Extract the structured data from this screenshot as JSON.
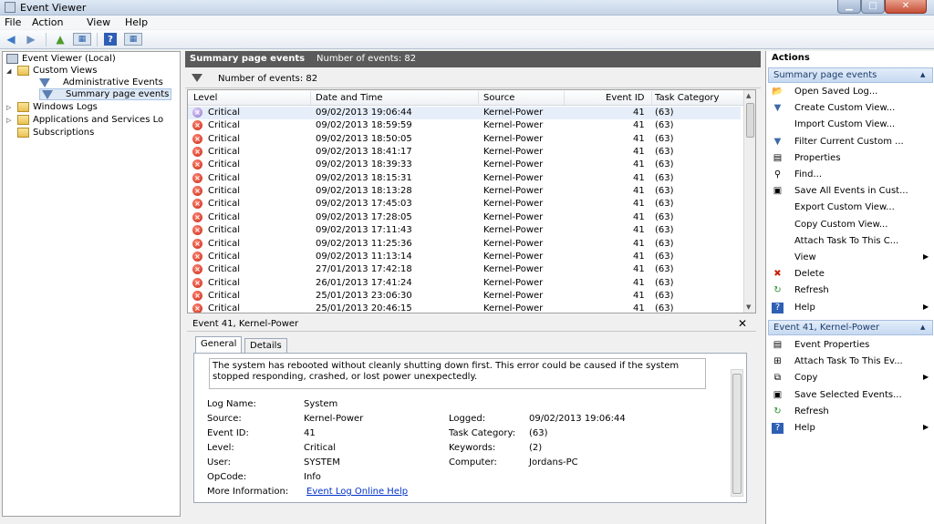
{
  "window": {
    "title": "Event Viewer",
    "minimize_glyph": "▁",
    "maximize_glyph": "□",
    "close_glyph": "✕"
  },
  "menu": [
    {
      "label": "File",
      "key": "F"
    },
    {
      "label": "Action",
      "key": "A"
    },
    {
      "label": "View",
      "key": "V"
    },
    {
      "label": "Help",
      "key": "H"
    }
  ],
  "toolbar": {
    "back_icon": "◀",
    "forward_icon": "▶",
    "folder_icon": "▲",
    "panel_icon": "▦",
    "help_icon": "?",
    "panel2_icon": "▦"
  },
  "tree": {
    "root": "Event Viewer (Local)",
    "custom_views": "Custom Views",
    "admin_events": "Administrative Events",
    "summary_events": "Summary page events",
    "windows_logs": "Windows Logs",
    "apps_services": "Applications and Services Lo",
    "subscriptions": "Subscriptions"
  },
  "center": {
    "header_name": "Summary page events",
    "header_count": "Number of events: 82",
    "filter_text": "Number of events: 82"
  },
  "grid": {
    "columns": [
      "Level",
      "Date and Time",
      "Source",
      "Event ID",
      "Task Category"
    ],
    "rows": [
      {
        "level": "Critical",
        "date": "09/02/2013 19:06:44",
        "source": "Kernel-Power",
        "id": "41",
        "task": "(63)"
      },
      {
        "level": "Critical",
        "date": "09/02/2013 18:59:59",
        "source": "Kernel-Power",
        "id": "41",
        "task": "(63)"
      },
      {
        "level": "Critical",
        "date": "09/02/2013 18:50:05",
        "source": "Kernel-Power",
        "id": "41",
        "task": "(63)"
      },
      {
        "level": "Critical",
        "date": "09/02/2013 18:41:17",
        "source": "Kernel-Power",
        "id": "41",
        "task": "(63)"
      },
      {
        "level": "Critical",
        "date": "09/02/2013 18:39:33",
        "source": "Kernel-Power",
        "id": "41",
        "task": "(63)"
      },
      {
        "level": "Critical",
        "date": "09/02/2013 18:15:31",
        "source": "Kernel-Power",
        "id": "41",
        "task": "(63)"
      },
      {
        "level": "Critical",
        "date": "09/02/2013 18:13:28",
        "source": "Kernel-Power",
        "id": "41",
        "task": "(63)"
      },
      {
        "level": "Critical",
        "date": "09/02/2013 17:45:03",
        "source": "Kernel-Power",
        "id": "41",
        "task": "(63)"
      },
      {
        "level": "Critical",
        "date": "09/02/2013 17:28:05",
        "source": "Kernel-Power",
        "id": "41",
        "task": "(63)"
      },
      {
        "level": "Critical",
        "date": "09/02/2013 17:11:43",
        "source": "Kernel-Power",
        "id": "41",
        "task": "(63)"
      },
      {
        "level": "Critical",
        "date": "09/02/2013 11:25:36",
        "source": "Kernel-Power",
        "id": "41",
        "task": "(63)"
      },
      {
        "level": "Critical",
        "date": "09/02/2013 11:13:14",
        "source": "Kernel-Power",
        "id": "41",
        "task": "(63)"
      },
      {
        "level": "Critical",
        "date": "27/01/2013 17:42:18",
        "source": "Kernel-Power",
        "id": "41",
        "task": "(63)"
      },
      {
        "level": "Critical",
        "date": "26/01/2013 17:41:24",
        "source": "Kernel-Power",
        "id": "41",
        "task": "(63)"
      },
      {
        "level": "Critical",
        "date": "25/01/2013 23:06:30",
        "source": "Kernel-Power",
        "id": "41",
        "task": "(63)"
      },
      {
        "level": "Critical",
        "date": "25/01/2013 20:46:15",
        "source": "Kernel-Power",
        "id": "41",
        "task": "(63)"
      }
    ]
  },
  "detail": {
    "title": "Event 41, Kernel-Power",
    "close_glyph": "✕",
    "tabs": [
      "General",
      "Details"
    ],
    "description": "The system has rebooted without cleanly shutting down first. This error could be caused if the system stopped responding, crashed, or lost power unexpectedly.",
    "fields": {
      "log_name_label": "Log Name:",
      "log_name": "System",
      "source_label": "Source:",
      "source": "Kernel-Power",
      "event_id_label": "Event ID:",
      "event_id": "41",
      "level_label": "Level:",
      "level": "Critical",
      "user_label": "User:",
      "user": "SYSTEM",
      "opcode_label": "OpCode:",
      "opcode": "Info",
      "more_info_label": "More Information:",
      "more_info_link": "Event Log Online Help",
      "logged_label": "Logged:",
      "logged": "09/02/2013 19:06:44",
      "task_label": "Task Category:",
      "task": "(63)",
      "keywords_label": "Keywords:",
      "keywords": "(2)",
      "computer_label": "Computer:",
      "computer": "Jordans-PC"
    }
  },
  "actions": {
    "title": "Actions",
    "section1": "Summary page events",
    "section1_items": [
      {
        "label": "Open Saved Log...",
        "icon": "folder-open-icon",
        "glyph": "📂"
      },
      {
        "label": "Create Custom View...",
        "icon": "filter-icon",
        "glyph": "▼"
      },
      {
        "label": "Import Custom View...",
        "icon": "",
        "glyph": ""
      },
      {
        "label": "Filter Current Custom ...",
        "icon": "filter-icon",
        "glyph": "▼"
      },
      {
        "label": "Properties",
        "icon": "properties-icon",
        "glyph": "▤"
      },
      {
        "label": "Find...",
        "icon": "binoculars-icon",
        "glyph": "⚲"
      },
      {
        "label": "Save All Events in Cust...",
        "icon": "save-icon",
        "glyph": "▣"
      },
      {
        "label": "Export Custom View...",
        "icon": "",
        "glyph": ""
      },
      {
        "label": "Copy Custom View...",
        "icon": "",
        "glyph": ""
      },
      {
        "label": "Attach Task To This C...",
        "icon": "",
        "glyph": ""
      },
      {
        "label": "View",
        "icon": "",
        "glyph": "",
        "submenu": true
      },
      {
        "label": "Delete",
        "icon": "delete-icon",
        "glyph": "✖"
      },
      {
        "label": "Refresh",
        "icon": "refresh-icon",
        "glyph": "↻"
      },
      {
        "label": "Help",
        "icon": "help-icon",
        "glyph": "?",
        "submenu": true
      }
    ],
    "section2": "Event 41, Kernel-Power",
    "section2_items": [
      {
        "label": "Event Properties",
        "icon": "properties-icon",
        "glyph": "▤"
      },
      {
        "label": "Attach Task To This Ev...",
        "icon": "task-icon",
        "glyph": "⊞"
      },
      {
        "label": "Copy",
        "icon": "copy-icon",
        "glyph": "⧉",
        "submenu": true
      },
      {
        "label": "Save Selected Events...",
        "icon": "save-icon",
        "glyph": "▣"
      },
      {
        "label": "Refresh",
        "icon": "refresh-icon",
        "glyph": "↻"
      },
      {
        "label": "Help",
        "icon": "help-icon",
        "glyph": "?",
        "submenu": true
      }
    ],
    "caret_glyph": "▲",
    "submenu_glyph": "▶"
  },
  "colors": {
    "accent": "#2f5fb4",
    "critical": "#c8230e",
    "link": "#0033cc",
    "header_dark": "#5a5a5a"
  }
}
